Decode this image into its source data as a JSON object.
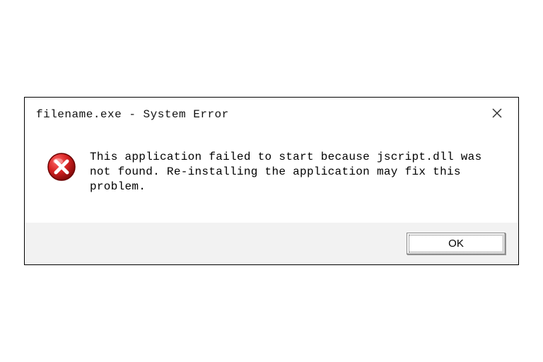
{
  "dialog": {
    "title": "filename.exe - System Error",
    "message": "This application failed to start because jscript.dll was not found. Re-installing the application may fix this problem.",
    "ok_label": "OK",
    "icon": "error-icon"
  }
}
